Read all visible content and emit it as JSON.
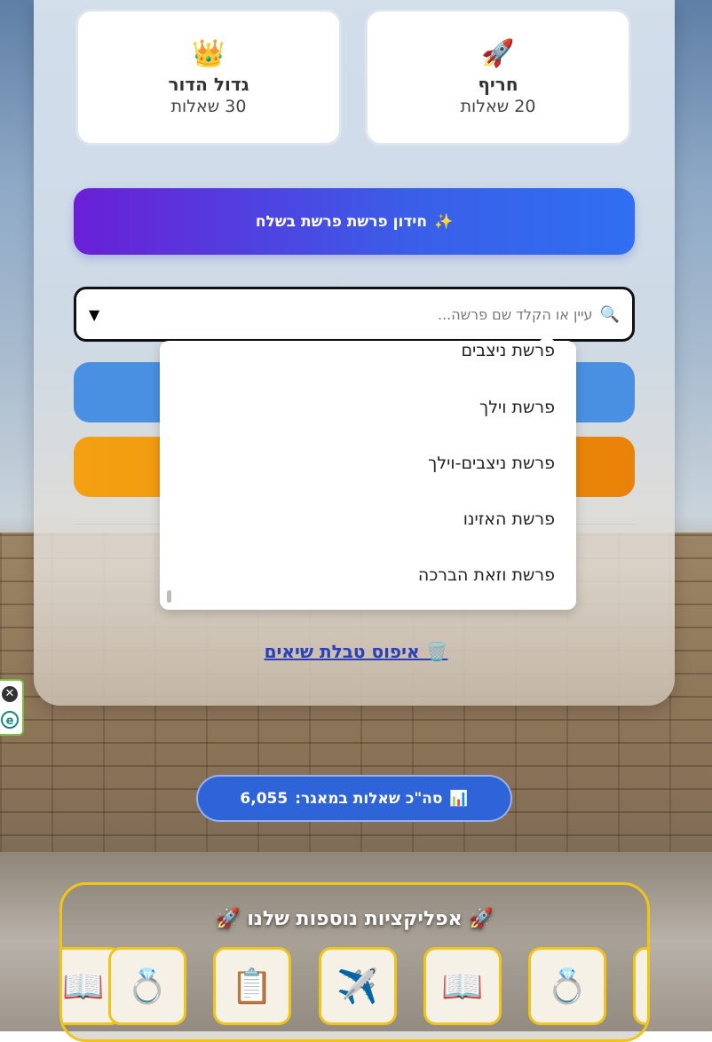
{
  "cards": [
    {
      "icon": "🚀",
      "icon_name": "rocket-icon",
      "title": "חריף",
      "subtitle": "20 שאלות"
    },
    {
      "icon": "👑",
      "icon_name": "crown-icon",
      "title": "גדול הדור",
      "subtitle": "30 שאלות"
    }
  ],
  "quiz_button": {
    "icon": "✨",
    "label": "חידון פרשת פרשת בשלח"
  },
  "search": {
    "placeholder": "עיין או הקלד שם פרשה...",
    "icon": "🔍",
    "arrow": "▼"
  },
  "dropdown": {
    "items": [
      "פרשת ניצבים",
      "פרשת וילך",
      "פרשת ניצבים-וילך",
      "פרשת האזינו",
      "פרשת וזאת הברכה"
    ]
  },
  "reset": {
    "icon": "🗑️",
    "label": "איפוס טבלת שיאים"
  },
  "side_widget": {
    "close": "✕",
    "badge": "e"
  },
  "stats": {
    "icon": "📊",
    "label": "סה\"כ שאלות במאגר:",
    "value": "6,055"
  },
  "apps": {
    "title": "🚀 אפליקציות נוספות שלנו 🚀",
    "items": [
      {
        "name": "app-ring",
        "icon": "💍"
      },
      {
        "name": "app-study",
        "icon": "📖"
      },
      {
        "name": "app-military",
        "icon": "✈️"
      },
      {
        "name": "app-checklist",
        "icon": "📋"
      },
      {
        "name": "app-ring-2",
        "icon": "💍"
      }
    ]
  },
  "colors": {
    "quiz_gradient_start": "#6a1fd6",
    "quiz_gradient_end": "#2f6ff2",
    "blue_button": "#4a90e2",
    "orange_button": "#f4a012",
    "stat_pill": "#2f63d8",
    "apps_border": "#f0c419"
  }
}
